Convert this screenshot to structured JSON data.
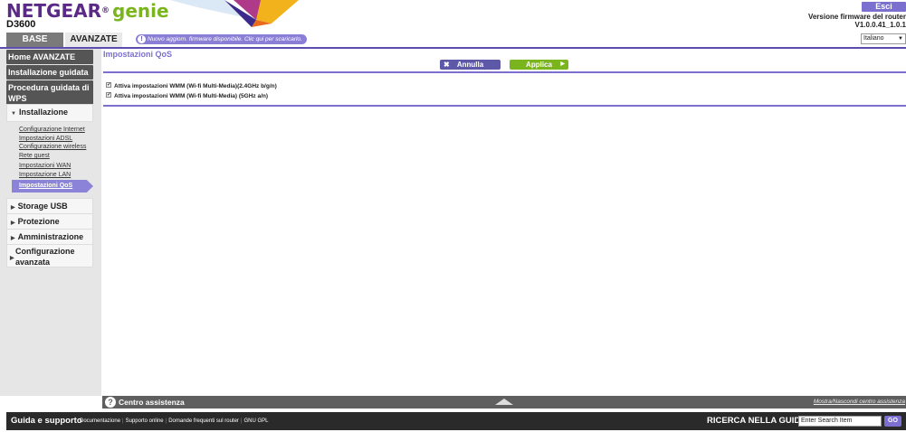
{
  "header": {
    "brand": "NETGEAR",
    "brand_reg": "®",
    "brand_genie": "genie",
    "model": "D3600",
    "logout_label": "Esci",
    "firmware_label": "Versione firmware del router",
    "firmware_version": "V1.0.0.41_1.0.1",
    "language": "Italiano",
    "tabs": [
      {
        "label": "BASE"
      },
      {
        "label": "AVANZATE"
      }
    ],
    "fw_notice": "Nuovo aggiorn. firmware disponibile. Clic qui per scaricarlo.",
    "fw_notice_icon": "!"
  },
  "sidebar": {
    "home": "Home AVANZATE",
    "setup_wizard": "Installazione guidata",
    "wps_wizard": "Procedura guidata di WPS",
    "categories": {
      "setup": "Installazione",
      "usb": "Storage USB",
      "security": "Protezione",
      "admin": "Amministrazione",
      "advanced": "Configurazione avanzata"
    },
    "setup_items": [
      "Configurazione Internet",
      "Impostazioni ADSL",
      "Configurazione wireless",
      "Rete guest",
      "Impostazioni WAN",
      "Impostazione LAN",
      "Impostazioni QoS"
    ]
  },
  "main": {
    "title": "Impostazioni QoS",
    "cancel_label": "Annulla",
    "apply_label": "Applica",
    "checkboxes": [
      {
        "label": "Attiva impostazioni WMM (Wi-fi Multi-Media)(2.4GHz b/g/n)",
        "checked": true
      },
      {
        "label": "Attiva impostazioni WMM (Wi-fi Multi-Media) (5GHz a/n)",
        "checked": true
      }
    ]
  },
  "help": {
    "icon": "?",
    "title": "Centro assistenza",
    "toggle": "Mostra/Nascondi centro assistenza"
  },
  "footer": {
    "title": "Guida e supporto",
    "links": [
      "Documentazione",
      "Supporto online",
      "Domande frequenti sul router",
      "GNU GPL"
    ],
    "search_label": "RICERCA NELLA GUIDA",
    "search_placeholder": "Enter Search Item",
    "go_label": "GO"
  },
  "colors": {
    "accent": "#7b6fd0",
    "brand_purple": "#5b2a86",
    "apply_green": "#7ab51d"
  }
}
